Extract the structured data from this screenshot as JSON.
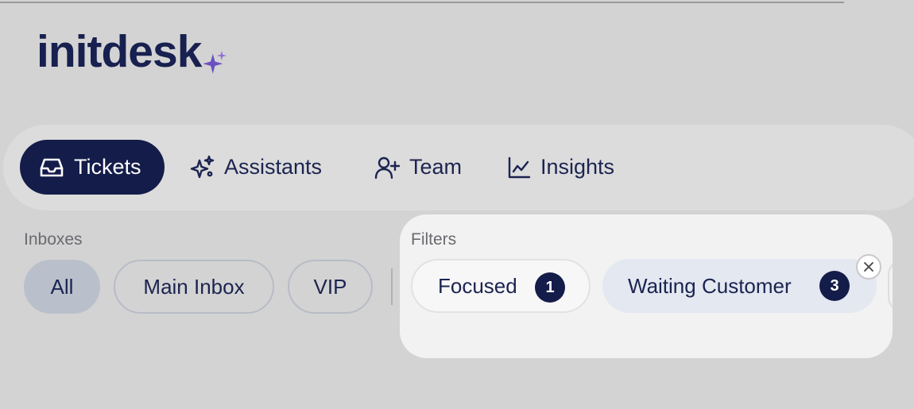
{
  "brand": {
    "name": "initdesk",
    "accent": "#7b5cc4"
  },
  "nav": {
    "items": [
      {
        "label": "Tickets",
        "icon": "inbox-icon",
        "active": true
      },
      {
        "label": "Assistants",
        "icon": "sparkles-icon",
        "active": false
      },
      {
        "label": "Team",
        "icon": "user-plus-icon",
        "active": false
      },
      {
        "label": "Insights",
        "icon": "line-chart-icon",
        "active": false
      }
    ]
  },
  "inboxes": {
    "label": "Inboxes",
    "chips": [
      {
        "label": "All",
        "selected": true
      },
      {
        "label": "Main Inbox",
        "selected": false
      },
      {
        "label": "VIP",
        "selected": false
      }
    ]
  },
  "filters": {
    "label": "Filters",
    "chips": [
      {
        "label": "Focused",
        "count": "1"
      },
      {
        "label": "Waiting Customer",
        "count": "3"
      }
    ]
  },
  "colors": {
    "primary": "#141c4a",
    "background": "#d3d3d3",
    "panel": "#f2f2f2"
  }
}
